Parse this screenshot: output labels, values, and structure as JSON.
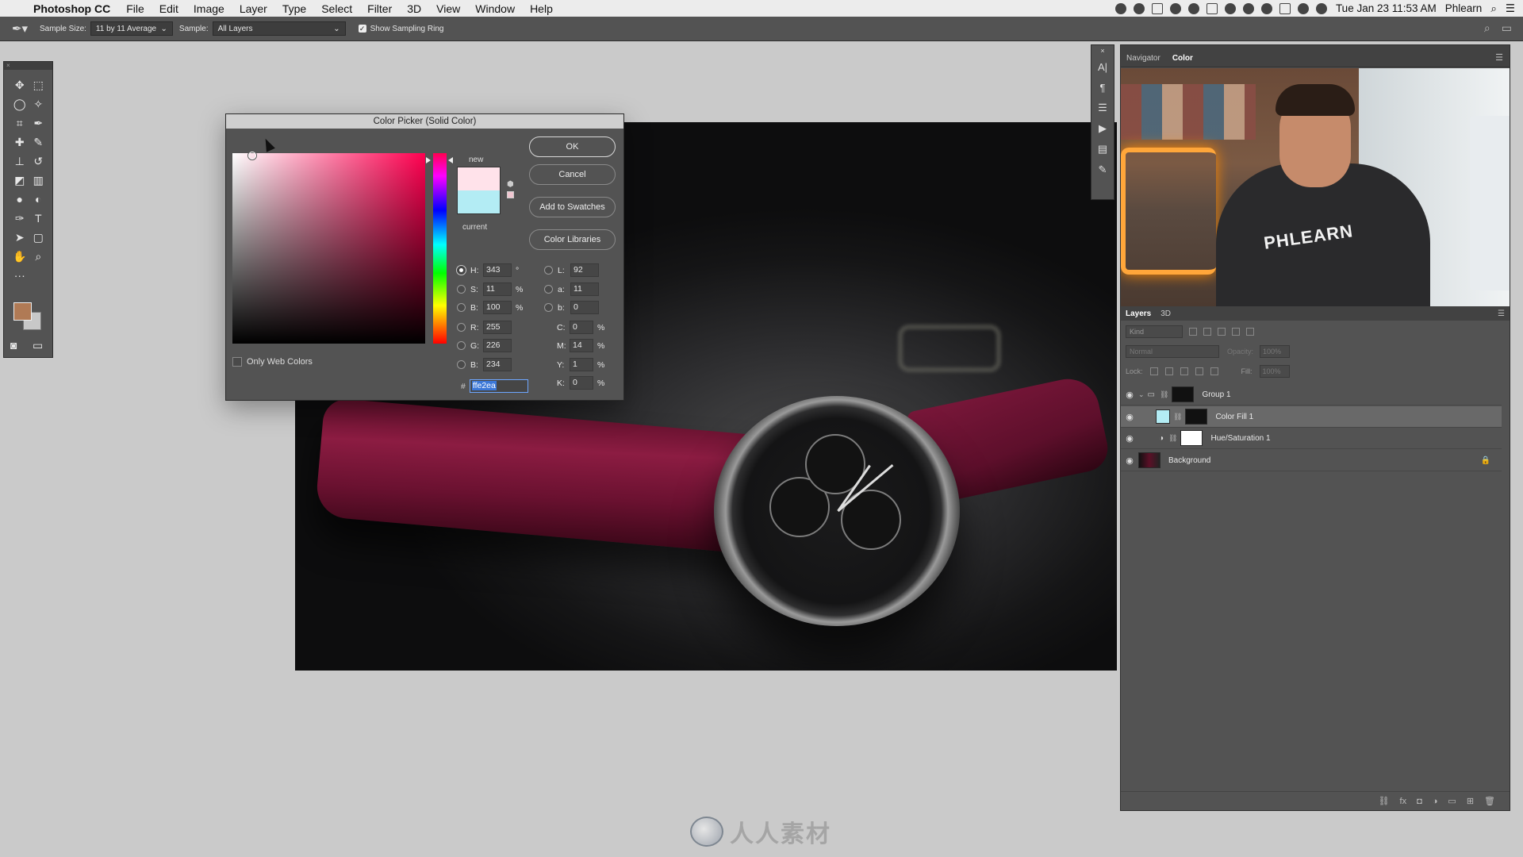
{
  "menubar": {
    "app_name": "Photoshop CC",
    "items": [
      "File",
      "Edit",
      "Image",
      "Layer",
      "Type",
      "Select",
      "Filter",
      "3D",
      "View",
      "Window",
      "Help"
    ],
    "clock": "Tue Jan 23  11:53 AM",
    "user": "Phlearn"
  },
  "options": {
    "sample_size_label": "Sample Size:",
    "sample_size_value": "11 by 11 Average",
    "sample_label": "Sample:",
    "sample_value": "All Layers",
    "show_ring_label": "Show Sampling Ring"
  },
  "dialog": {
    "title": "Color Picker (Solid Color)",
    "new_label": "new",
    "current_label": "current",
    "ok_label": "OK",
    "cancel_label": "Cancel",
    "add_swatches_label": "Add to Swatches",
    "color_libraries_label": "Color Libraries",
    "hsb": [
      {
        "label": "H:",
        "value": "343",
        "unit": "°"
      },
      {
        "label": "S:",
        "value": "11",
        "unit": "%"
      },
      {
        "label": "B:",
        "value": "100",
        "unit": "%"
      }
    ],
    "rgb": [
      {
        "label": "R:",
        "value": "255"
      },
      {
        "label": "G:",
        "value": "226"
      },
      {
        "label": "B:",
        "value": "234"
      }
    ],
    "lab": [
      {
        "label": "L:",
        "value": "92"
      },
      {
        "label": "a:",
        "value": "11"
      },
      {
        "label": "b:",
        "value": "0"
      }
    ],
    "cmyk": [
      {
        "label": "C:",
        "value": "0",
        "unit": "%"
      },
      {
        "label": "M:",
        "value": "14",
        "unit": "%"
      },
      {
        "label": "Y:",
        "value": "1",
        "unit": "%"
      },
      {
        "label": "K:",
        "value": "0",
        "unit": "%"
      }
    ],
    "hex_prefix": "#",
    "hex_value": "ffe2ea",
    "web_colors_label": "Only Web Colors",
    "new_color": "#ffe2ea",
    "current_color": "#b3ecf4"
  },
  "right_panel": {
    "tabs": [
      "Navigator",
      "Color"
    ],
    "active_tab": "Color",
    "shirt_text": "PHLEARN",
    "layers_tabs": [
      "Layers",
      "3D"
    ],
    "filter_kind": "Kind",
    "blend_mode": "Normal",
    "opacity_label": "Opacity:",
    "opacity_value": "100%",
    "lock_label": "Lock:",
    "fill_label": "Fill:",
    "fill_value": "100%",
    "layers": [
      {
        "name": "Group 1"
      },
      {
        "name": "Color Fill 1"
      },
      {
        "name": "Hue/Saturation 1"
      },
      {
        "name": "Background"
      }
    ]
  },
  "watermark_brand": "人人素材"
}
